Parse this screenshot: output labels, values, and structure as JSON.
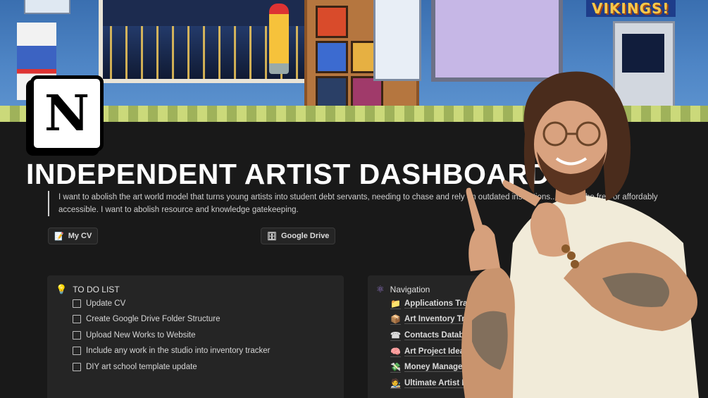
{
  "cover": {
    "sign_text": "VIKINGS!"
  },
  "logo": {
    "letter": "N"
  },
  "page": {
    "title": "INDEPENDENT ARTIST DASHBOARD",
    "quote": "I want to abolish the art world model that turns young artists into student debt servants, needing to chase and rely on outdated institutions... should be free or affordably accessible. I want to abolish resource and knowledge gatekeeping."
  },
  "links": [
    {
      "label": "My CV",
      "icon": "memo-icon"
    },
    {
      "label": "Google Drive",
      "icon": "cabinet-icon"
    }
  ],
  "todo": {
    "heading": "TO DO LIST",
    "icon": "lightbulb-icon",
    "items": [
      "Update CV",
      "Create Google Drive Folder Structure",
      "Upload New Works to Website",
      "Include any work in the studio into inventory tracker",
      "DIY art school template update"
    ]
  },
  "navigation": {
    "heading": "Navigation",
    "icon": "atom-icon",
    "items": [
      {
        "label": "Applications Tracke",
        "icon": "folder-icon"
      },
      {
        "label": "Art Inventory Track",
        "icon": "box-icon"
      },
      {
        "label": "Contacts Databas",
        "icon": "phone-icon"
      },
      {
        "label": "Art Project Ideas",
        "icon": "brain-icon"
      },
      {
        "label": "Money Manager",
        "icon": "money-icon"
      },
      {
        "label": "Ultimate Artist Resour",
        "icon": "artist-icon"
      }
    ]
  },
  "colors": {
    "background": "#191919",
    "card": "#252525",
    "title": "#ffffff"
  }
}
